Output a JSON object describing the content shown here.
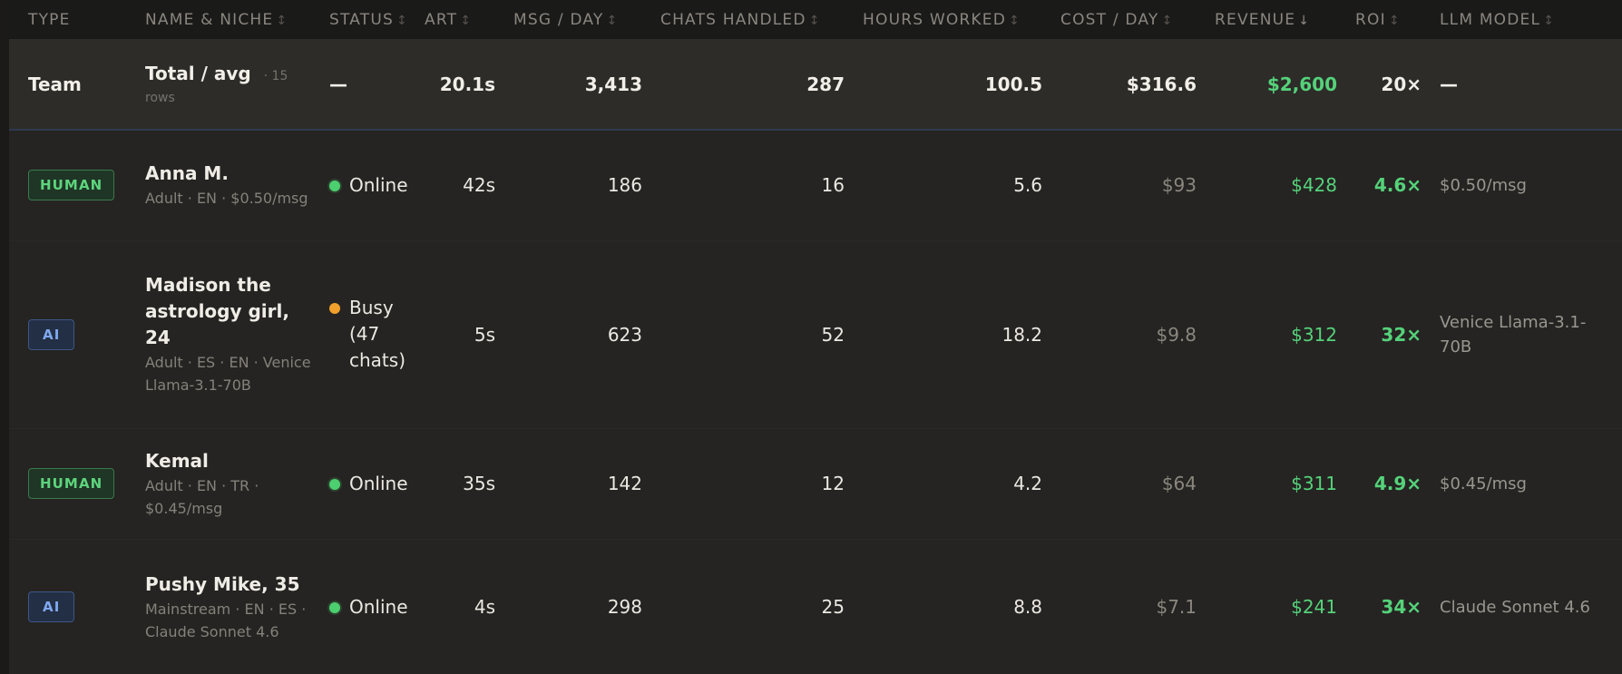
{
  "columns": [
    {
      "label": "TYPE",
      "sort": ""
    },
    {
      "label": "NAME & NICHE",
      "sort": "↕"
    },
    {
      "label": "STATUS",
      "sort": "↕"
    },
    {
      "label": "ART",
      "sort": "↕"
    },
    {
      "label": "MSG / DAY",
      "sort": "↕"
    },
    {
      "label": "CHATS HANDLED",
      "sort": "↕"
    },
    {
      "label": "HOURS WORKED",
      "sort": "↕"
    },
    {
      "label": "COST / DAY",
      "sort": "↕"
    },
    {
      "label": "REVENUE",
      "sort": "↓"
    },
    {
      "label": "ROI",
      "sort": "↕"
    },
    {
      "label": "LLM MODEL",
      "sort": "↕"
    }
  ],
  "total": {
    "type": "Team",
    "name": "Total / avg",
    "rows_note": "· 15 rows",
    "status": "—",
    "art": "20.1s",
    "msg_day": "3,413",
    "chats": "287",
    "hours": "100.5",
    "cost": "$316.6",
    "revenue": "$2,600",
    "roi": "20×",
    "llm": "—"
  },
  "rows": [
    {
      "type": "HUMAN",
      "name": "Anna M.",
      "niche": "Adult · EN · $0.50/msg",
      "status": "Online",
      "status_color": "#4ccf6e",
      "art": "42s",
      "msg_day": "186",
      "chats": "16",
      "hours": "5.6",
      "cost": "$93",
      "revenue": "$428",
      "roi": "4.6×",
      "llm": "$0.50/msg"
    },
    {
      "type": "AI",
      "name": "Madison the astrology girl, 24",
      "niche": "Adult · ES · EN · Venice Llama-3.1-70B",
      "status": "Busy (47 chats)",
      "status_color": "#f2a02c",
      "art": "5s",
      "msg_day": "623",
      "chats": "52",
      "hours": "18.2",
      "cost": "$9.8",
      "revenue": "$312",
      "roi": "32×",
      "llm": "Venice Llama-3.1-70B"
    },
    {
      "type": "HUMAN",
      "name": "Kemal",
      "niche": "Adult · EN · TR · $0.45/msg",
      "status": "Online",
      "status_color": "#4ccf6e",
      "art": "35s",
      "msg_day": "142",
      "chats": "12",
      "hours": "4.2",
      "cost": "$64",
      "revenue": "$311",
      "roi": "4.9×",
      "llm": "$0.45/msg"
    },
    {
      "type": "AI",
      "name": "Pushy Mike, 35",
      "niche": "Mainstream · EN · ES · Claude Sonnet 4.6",
      "status": "Online",
      "status_color": "#4ccf6e",
      "art": "4s",
      "msg_day": "298",
      "chats": "25",
      "hours": "8.8",
      "cost": "$7.1",
      "revenue": "$241",
      "roi": "34×",
      "llm": "Claude Sonnet 4.6"
    }
  ]
}
